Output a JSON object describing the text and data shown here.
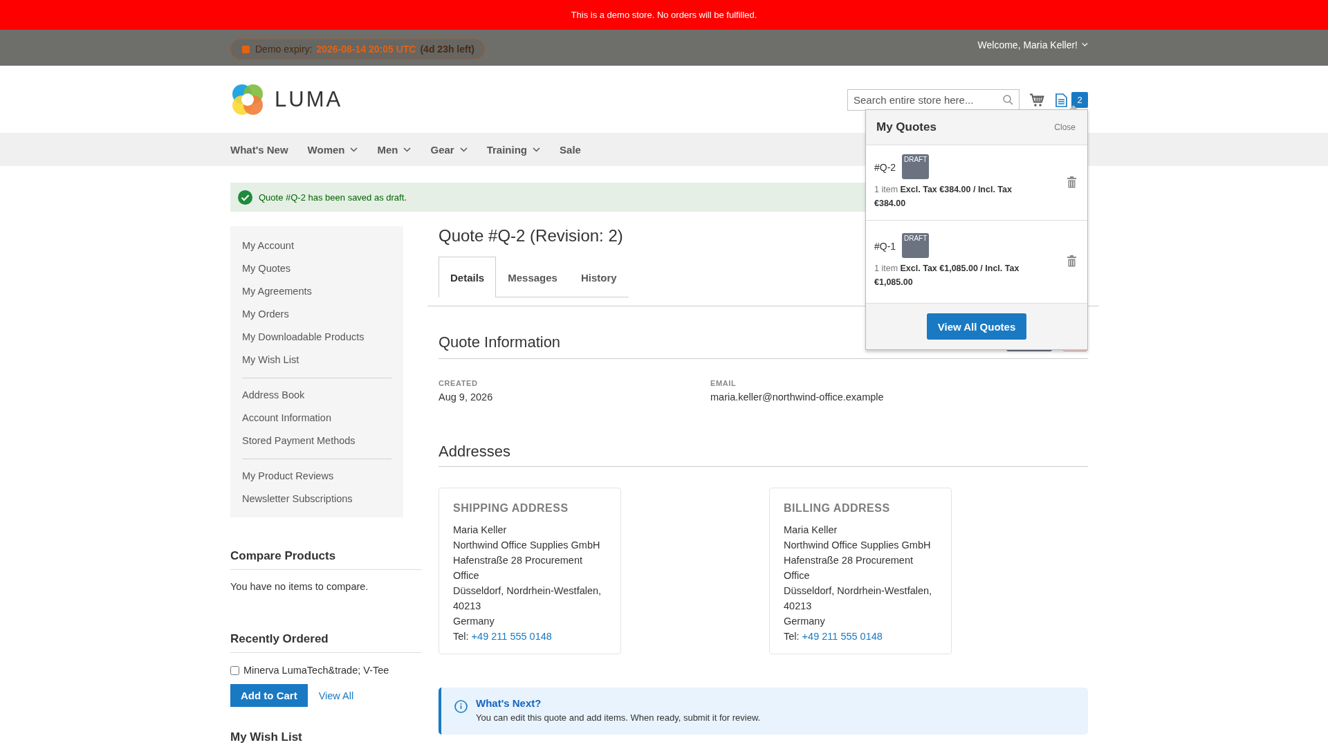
{
  "demo_notice": "This is a demo store. No orders will be fulfilled.",
  "top_bar": {
    "expiry_label": "Demo expiry:",
    "expiry_date": "2026-08-14 20:05 UTC",
    "expiry_left": "(4d 23h left)",
    "welcome": "Welcome, Maria Keller!"
  },
  "header": {
    "logo_text": "LUMA",
    "search": {
      "placeholder": "Search entire store here..."
    },
    "quotes_count": "2"
  },
  "nav": [
    {
      "label": "What's New",
      "has_menu": false
    },
    {
      "label": "Women",
      "has_menu": true
    },
    {
      "label": "Men",
      "has_menu": true
    },
    {
      "label": "Gear",
      "has_menu": true
    },
    {
      "label": "Training",
      "has_menu": true
    },
    {
      "label": "Sale",
      "has_menu": false
    }
  ],
  "message": "Quote #Q-2 has been saved as draft.",
  "sidebar": {
    "groups": [
      [
        "My Account",
        "My Quotes",
        "My Agreements",
        "My Orders",
        "My Downloadable Products",
        "My Wish List"
      ],
      [
        "Address Book",
        "Account Information",
        "Stored Payment Methods"
      ],
      [
        "My Product Reviews",
        "Newsletter Subscriptions"
      ]
    ]
  },
  "compare": {
    "title": "Compare Products",
    "text": "You have no items to compare."
  },
  "recently_ordered": {
    "title": "Recently Ordered",
    "items": [
      {
        "label": "Minerva LumaTech&trade; V-Tee",
        "checked": false
      }
    ],
    "add_button": "Add to Cart",
    "view_all": "View All"
  },
  "wishlist_title": "My Wish List",
  "quote": {
    "title": "Quote #Q-2 (Revision: 2)",
    "tabs": [
      {
        "label": "Details",
        "selected": true
      },
      {
        "label": "Messages",
        "selected": false
      },
      {
        "label": "History",
        "selected": false
      }
    ],
    "info_title": "Quote Information",
    "fields": [
      {
        "label": "CREATED",
        "value": "Aug 9, 2026"
      },
      {
        "label": "EMAIL",
        "value": "maria.keller@northwind-office.example"
      }
    ],
    "addresses_title": "Addresses",
    "addresses": [
      {
        "title": "SHIPPING ADDRESS",
        "lines": [
          "Maria Keller",
          "Northwind Office Supplies GmbH",
          "Hafenstraße 28 Procurement Office",
          "Düsseldorf, Nordrhein-Westfalen, 40213",
          "Germany"
        ],
        "tel_label": "Tel:",
        "tel": "+49 211 555 0148"
      },
      {
        "title": "BILLING ADDRESS",
        "lines": [
          "Maria Keller",
          "Northwind Office Supplies GmbH",
          "Hafenstraße 28 Procurement Office",
          "Düsseldorf, Nordrhein-Westfalen, 40213",
          "Germany"
        ],
        "tel_label": "Tel:",
        "tel": "+49 211 555 0148"
      }
    ],
    "next": {
      "title": "What's Next?",
      "text": "You can edit this quote and add items. When ready, submit it for review."
    }
  },
  "dropdown": {
    "title": "My Quotes",
    "close": "Close",
    "quotes": [
      {
        "number": "#Q-2",
        "status": "DRAFT",
        "count": "1 item",
        "totals": "Excl. Tax €384.00 / Incl. Tax €384.00"
      },
      {
        "number": "#Q-1",
        "status": "DRAFT",
        "count": "1 item",
        "totals": "Excl. Tax €1,085.00 / Incl. Tax €1,085.00"
      }
    ],
    "button": "View All Quotes"
  }
}
